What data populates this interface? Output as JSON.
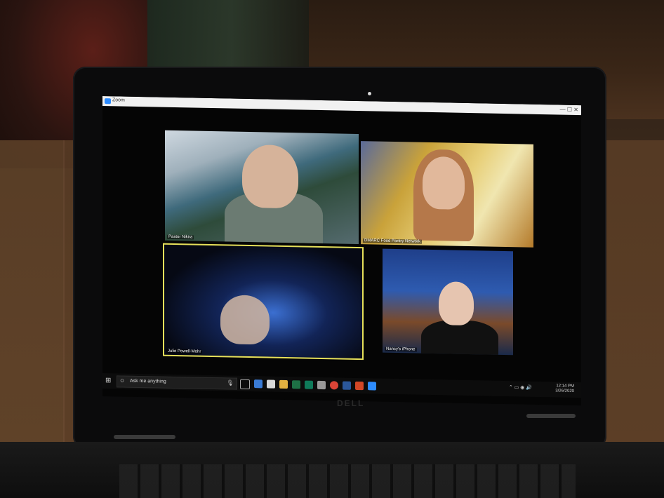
{
  "window": {
    "title": "Zoom",
    "controls": "— ☐ ✕"
  },
  "participants": [
    {
      "name": "Pastor Nikira"
    },
    {
      "name": "DMARC Food Pantry Network"
    },
    {
      "name": "Julie Powell-Mohr"
    },
    {
      "name": "Nancy's iPhone"
    }
  ],
  "taskbar": {
    "search_placeholder": "Ask me anything",
    "time": "12:14 PM",
    "date": "3/26/2020",
    "tray_icons": "⌃ ▭ ◉ 🔊"
  },
  "device": {
    "brand": "DELL"
  },
  "colors": {
    "active_speaker_border": "#e6e05a",
    "taskbar": "#0c0c0c",
    "zoom_blue": "#2d8cff"
  }
}
